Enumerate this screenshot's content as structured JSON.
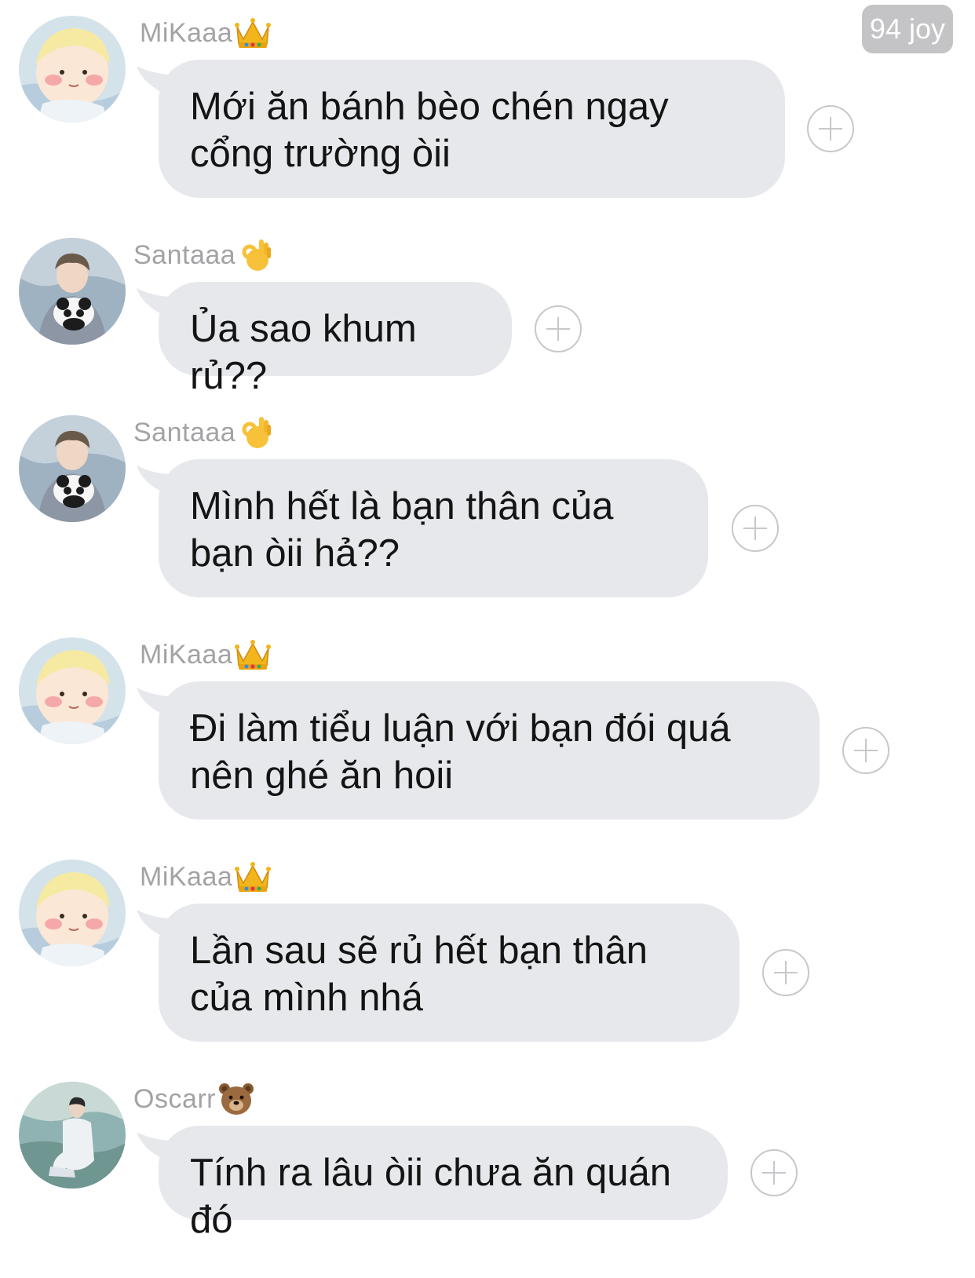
{
  "header": {
    "badge": "94 joy"
  },
  "messages": [
    {
      "name": "MiKaaa",
      "emoji": "crown-icon",
      "text": "Mới ăn bánh bèo chén ngay cổng trường òii",
      "avatar": "baby-cartoon-avatar"
    },
    {
      "name": "Santaaa",
      "emoji": "ok-hand-icon",
      "text": "Ủa sao khum rủ??",
      "avatar": "boy-with-panda-avatar"
    },
    {
      "name": "Santaaa",
      "emoji": "ok-hand-icon",
      "text": "Mình hết là bạn thân của bạn òii hả??",
      "avatar": "boy-with-panda-avatar"
    },
    {
      "name": "MiKaaa",
      "emoji": "crown-icon",
      "text": "Đi làm tiểu luận với bạn đói quá nên ghé ăn hoii",
      "avatar": "baby-cartoon-avatar"
    },
    {
      "name": "MiKaaa",
      "emoji": "crown-icon",
      "text": "Lần sau sẽ rủ hết bạn thân của mình nhá",
      "avatar": "baby-cartoon-avatar"
    },
    {
      "name": "Oscarr",
      "emoji": "bear-face-icon",
      "text": "Tính ra lâu òii chưa ăn quán đó",
      "avatar": "man-outdoor-avatar"
    }
  ],
  "colors": {
    "bubble": "#e6e8eb",
    "username": "#a3a3a6",
    "badge_bg": "#c4c4c6",
    "plus_outline": "#c8c8cc"
  }
}
